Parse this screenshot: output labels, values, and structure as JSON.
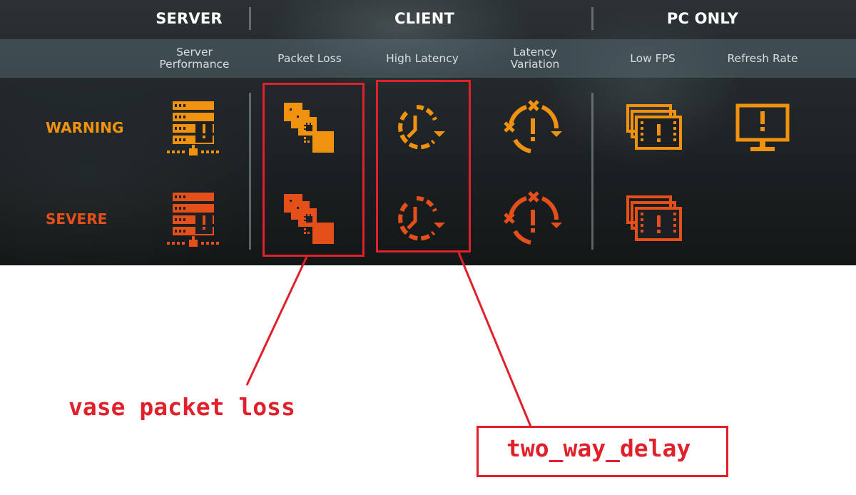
{
  "headers": {
    "server": "SERVER",
    "client": "CLIENT",
    "pc_only": "PC ONLY"
  },
  "columns": {
    "server_performance": "Server\nPerformance",
    "packet_loss": "Packet Loss",
    "high_latency": "High Latency",
    "latency_variation": "Latency\nVariation",
    "low_fps": "Low FPS",
    "refresh_rate": "Refresh Rate"
  },
  "rows": {
    "warning": "WARNING",
    "severe": "SEVERE"
  },
  "colors": {
    "warning": "#f0920f",
    "severe": "#e5501a",
    "annotation": "#e0202a"
  },
  "icons": [
    "server-performance-icon",
    "packet-loss-icon",
    "high-latency-icon",
    "latency-variation-icon",
    "low-fps-icon",
    "refresh-rate-icon"
  ],
  "annotations": {
    "packet_loss_note": "vase packet loss",
    "latency_note": "two_way_delay"
  }
}
